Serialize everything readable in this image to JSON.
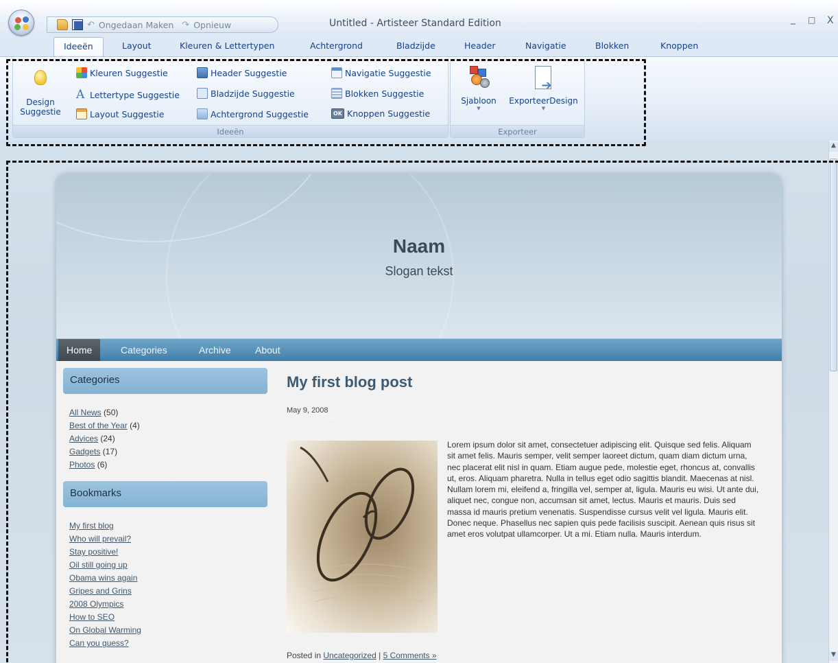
{
  "window": {
    "title": "Untitled - Artisteer Standard Edition",
    "minimize": "_",
    "maximize": "□",
    "close": "X"
  },
  "quick_access": {
    "undo_label": "Ongedaan Maken",
    "redo_label": "Opnieuw"
  },
  "tabs": [
    {
      "label": "Ideeën"
    },
    {
      "label": "Layout"
    },
    {
      "label": "Kleuren & Lettertypen"
    },
    {
      "label": "Achtergrond"
    },
    {
      "label": "Bladzijde"
    },
    {
      "label": "Header"
    },
    {
      "label": "Navigatie"
    },
    {
      "label": "Blokken"
    },
    {
      "label": "Knoppen"
    }
  ],
  "ribbon": {
    "ideas_group": {
      "label": "Ideeën",
      "design_line1": "Design",
      "design_line2": "Suggestie",
      "buttons": [
        "Kleuren Suggestie",
        "Lettertype Suggestie",
        "Layout Suggestie",
        "Header Suggestie",
        "Bladzijde Suggestie",
        "Achtergrond Suggestie",
        "Navigatie Suggestie",
        "Blokken Suggestie",
        "Knoppen Suggestie"
      ]
    },
    "export_group": {
      "label": "Exporteer",
      "template_label": "Sjabloon",
      "export_label": "ExporteerDesign"
    }
  },
  "site": {
    "name": "Naam",
    "slogan": "Slogan tekst",
    "nav": [
      "Home",
      "Categories",
      "Archive",
      "About"
    ],
    "categories": {
      "title": "Categories",
      "items": [
        {
          "label": "All News",
          "count": "(50)"
        },
        {
          "label": "Best of the Year",
          "count": "(4)"
        },
        {
          "label": "Advices",
          "count": "(24)"
        },
        {
          "label": "Gadgets",
          "count": "(17)"
        },
        {
          "label": "Photos",
          "count": "(6)"
        }
      ]
    },
    "bookmarks": {
      "title": "Bookmarks",
      "items": [
        "My first blog",
        "Who will prevail?",
        "Stay positive!",
        "Oil still going up",
        "Obama wins again",
        "Gripes and Grins",
        "2008 Olympics",
        "How to SEO",
        "On Global Warming",
        "Can you guess?"
      ]
    },
    "post": {
      "title": "My first blog post",
      "date": "May 9, 2008",
      "body": "Lorem ipsum dolor sit amet, consectetuer adipiscing elit. Quisque sed felis. Aliquam sit amet felis. Mauris semper, velit semper laoreet dictum, quam diam dictum urna, nec placerat elit nisl in quam. Etiam augue pede, molestie eget, rhoncus at, convallis ut, eros. Aliquam pharetra. Nulla in tellus eget odio sagittis blandit. Maecenas at nisl. Nullam lorem mi, eleifend a, fringilla vel, semper at, ligula. Mauris eu wisi. Ut ante dui, aliquet nec, congue non, accumsan sit amet, lectus. Mauris et mauris. Duis sed massa id mauris pretium venenatis. Suspendisse cursus velit vel ligula. Mauris elit. Donec neque. Phasellus nec sapien quis pede facilisis suscipit. Aenean quis risus sit amet eros volutpat ullamcorper. Ut a mi. Etiam nulla. Mauris interdum.",
      "footer_prefix": "Posted in ",
      "category_link": "Uncategorized",
      "separator": " | ",
      "comments_link": "5 Comments »"
    }
  }
}
